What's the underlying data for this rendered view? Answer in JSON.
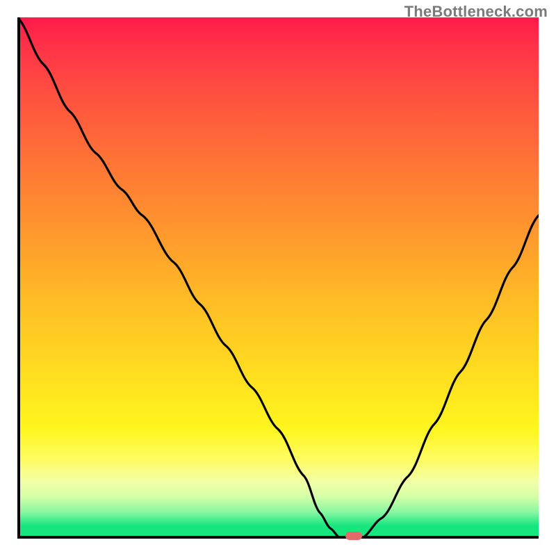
{
  "watermark": "TheBottleneck.com",
  "colors": {
    "gradient_top": "#ff1a4a",
    "gradient_bottom": "#17e57e",
    "curve": "#000000",
    "axis": "#000000",
    "marker": "#e56a6a"
  },
  "chart_data": {
    "type": "line",
    "title": "",
    "xlabel": "",
    "ylabel": "",
    "xlim": [
      0,
      100
    ],
    "ylim": [
      0,
      100
    ],
    "legend": false,
    "grid": false,
    "x": [
      0,
      5,
      10,
      15,
      20,
      24,
      30,
      35,
      40,
      45,
      50,
      55,
      58,
      60,
      62,
      64,
      66,
      70,
      75,
      80,
      85,
      90,
      95,
      100
    ],
    "y": [
      100,
      91,
      82,
      74,
      67,
      62,
      53,
      45,
      37,
      29,
      21,
      12,
      5,
      2,
      0,
      0,
      0,
      4,
      12,
      22,
      32,
      42,
      52,
      62
    ],
    "marker": {
      "x": 64.5,
      "y": 0
    },
    "annotations": []
  }
}
